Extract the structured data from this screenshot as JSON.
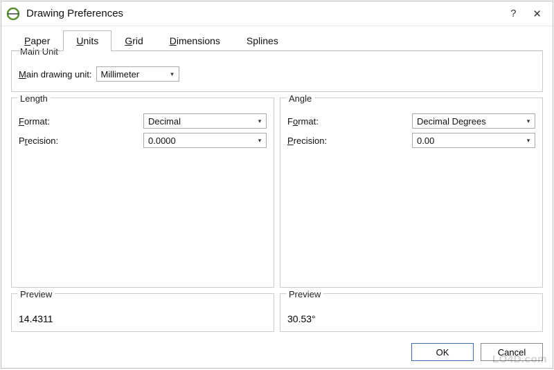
{
  "titlebar": {
    "title": "Drawing Preferences"
  },
  "tabs": {
    "paper": "Paper",
    "units": "Units",
    "grid": "Grid",
    "dimensions": "Dimensions",
    "splines": "Splines",
    "active": "units"
  },
  "main_unit": {
    "legend": "Main Unit",
    "label": "Main drawing unit:",
    "value": "Millimeter"
  },
  "length": {
    "legend": "Length",
    "format_label": "Format:",
    "format_value": "Decimal",
    "precision_label": "Precision:",
    "precision_value": "0.0000"
  },
  "angle": {
    "legend": "Angle",
    "format_label": "Format:",
    "format_value": "Decimal Degrees",
    "precision_label": "Precision:",
    "precision_value": "0.00"
  },
  "preview": {
    "legend": "Preview",
    "length_value": "14.4311",
    "angle_value": "30.53°"
  },
  "buttons": {
    "ok": "OK",
    "cancel": "Cancel"
  },
  "watermark": "LO4D.com"
}
